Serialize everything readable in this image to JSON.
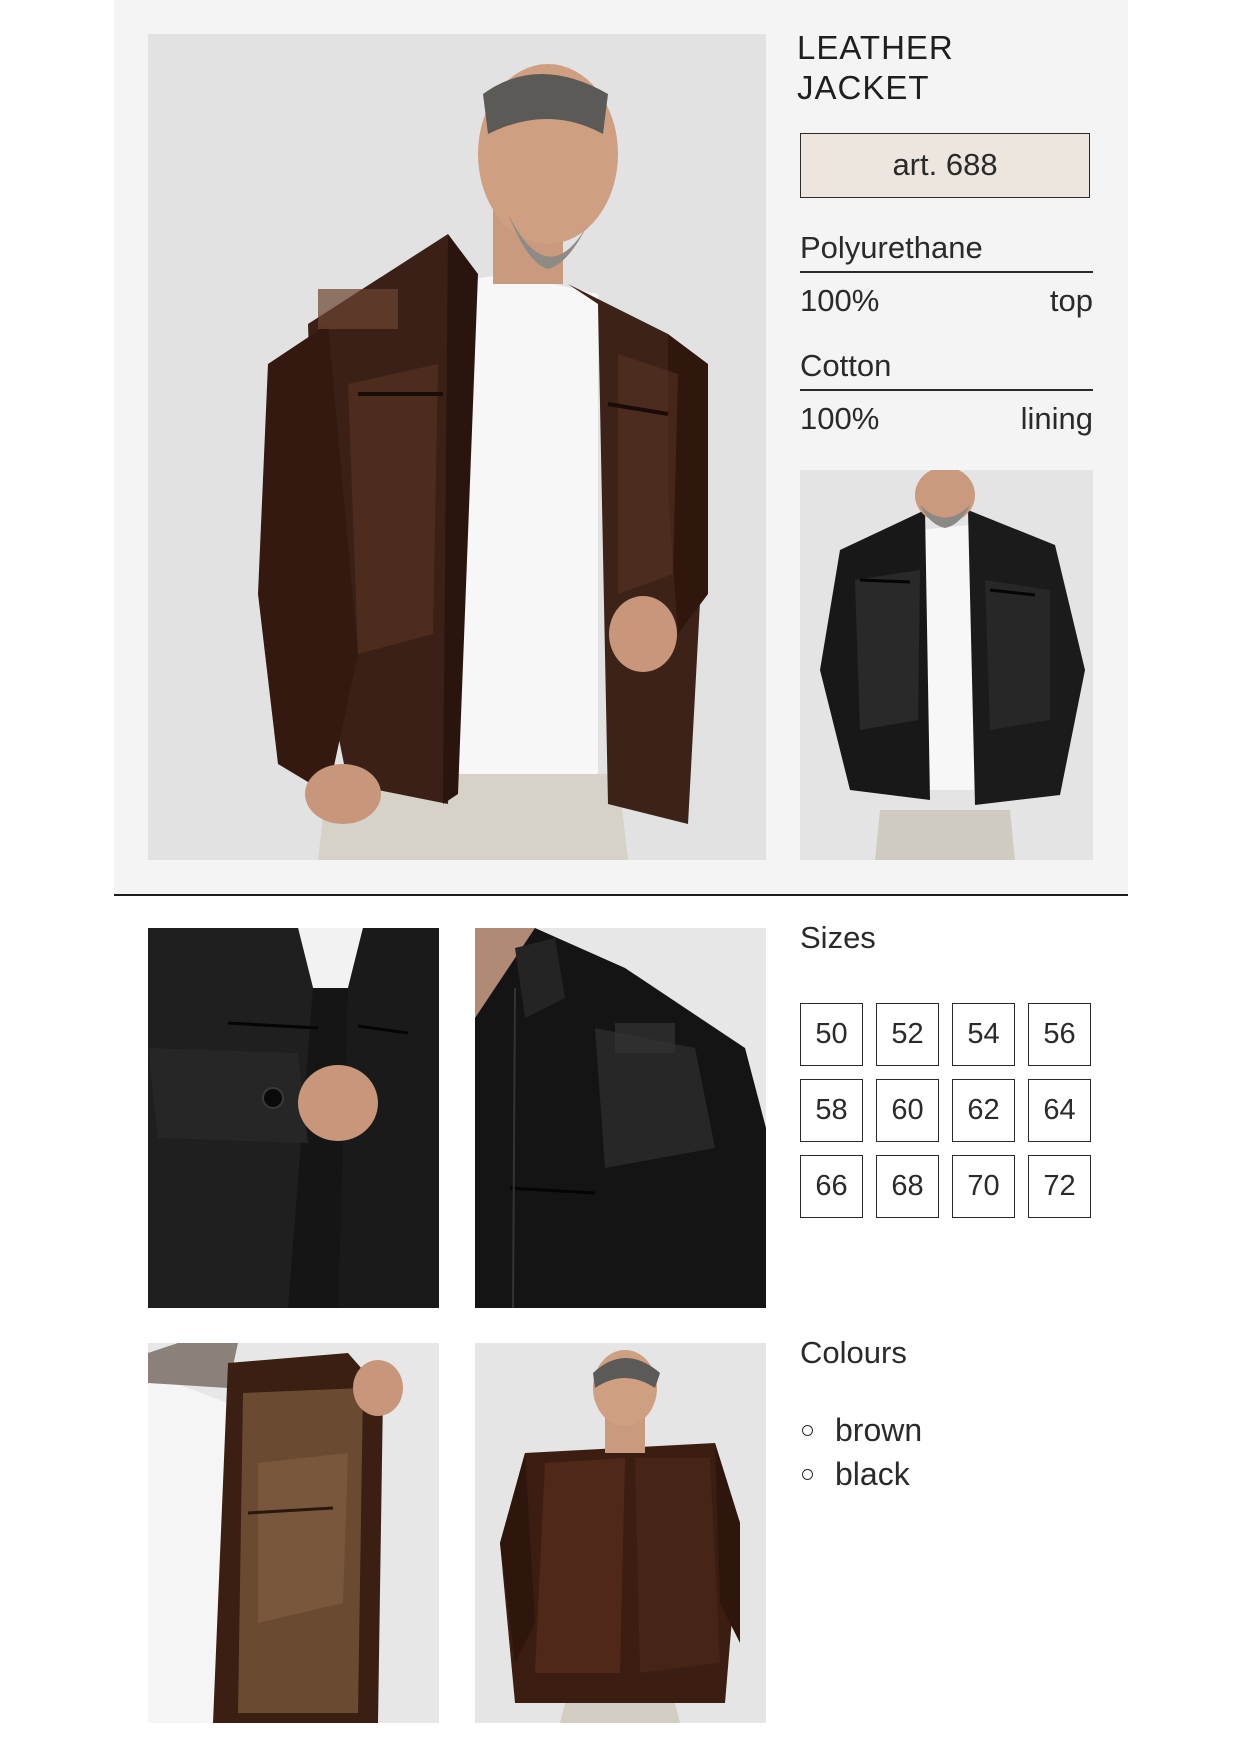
{
  "product": {
    "title_line1": "LEATHER",
    "title_line2": "JACKET",
    "article": "art. 688"
  },
  "materials": [
    {
      "name": "Polyurethane",
      "percent": "100%",
      "part": "top"
    },
    {
      "name": "Cotton",
      "percent": "100%",
      "part": "lining"
    }
  ],
  "sizes": {
    "heading": "Sizes",
    "values": [
      "50",
      "52",
      "54",
      "56",
      "58",
      "60",
      "62",
      "64",
      "66",
      "68",
      "70",
      "72"
    ]
  },
  "colours": {
    "heading": "Colours",
    "items": [
      "brown",
      "black"
    ]
  },
  "style": {
    "top_panel_bg": "#f4f4f4",
    "article_box_bg": "#ede6df",
    "text_color": "#2a2a2a"
  }
}
